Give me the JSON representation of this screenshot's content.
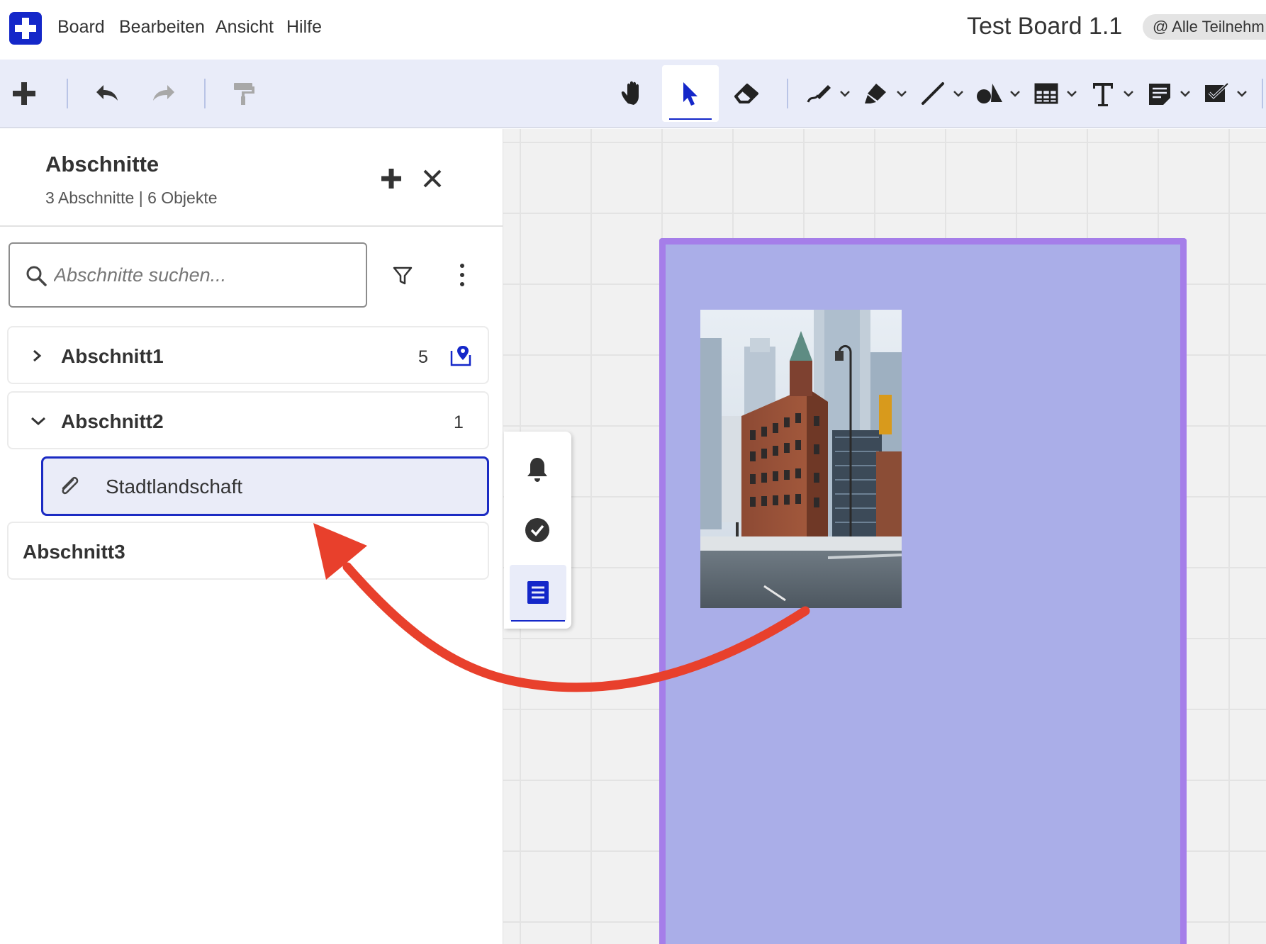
{
  "menu": {
    "items": [
      "Board",
      "Bearbeiten",
      "Ansicht",
      "Hilfe"
    ],
    "board_title": "Test Board 1.1",
    "participants": "@ Alle Teilnehm"
  },
  "toolbar": {
    "left_tools": [
      "add-icon",
      "undo-icon",
      "redo-icon",
      "format-painter-icon"
    ],
    "right_tools": [
      "hand-icon",
      "select-pointer-icon",
      "eraser-icon",
      "pen-icon",
      "marker-icon",
      "line-icon",
      "shapes-icon",
      "table-icon",
      "text-icon",
      "note-icon",
      "checkbox-icon"
    ],
    "active_tool": "select-pointer-icon"
  },
  "panel": {
    "title": "Abschnitte",
    "subtitle": "3 Abschnitte | 6 Objekte",
    "search_placeholder": "Abschnitte suchen...",
    "sections": [
      {
        "label": "Abschnitt1",
        "count": "5",
        "expanded": false
      },
      {
        "label": "Abschnitt2",
        "count": "1",
        "expanded": true
      },
      {
        "label": "Abschnitt3",
        "count": "",
        "expanded": false
      }
    ],
    "item": {
      "label": "Stadtlandschaft"
    }
  },
  "rail": {
    "icons": [
      "bell-icon",
      "check-circle-icon",
      "list-icon"
    ],
    "active": "list-icon"
  },
  "colors": {
    "brand": "#1427c9",
    "frame_fill": "#aaaee8",
    "frame_border": "#a57ee9",
    "arrow": "#e8402c",
    "toolbar_bg": "#e9ecf9"
  }
}
